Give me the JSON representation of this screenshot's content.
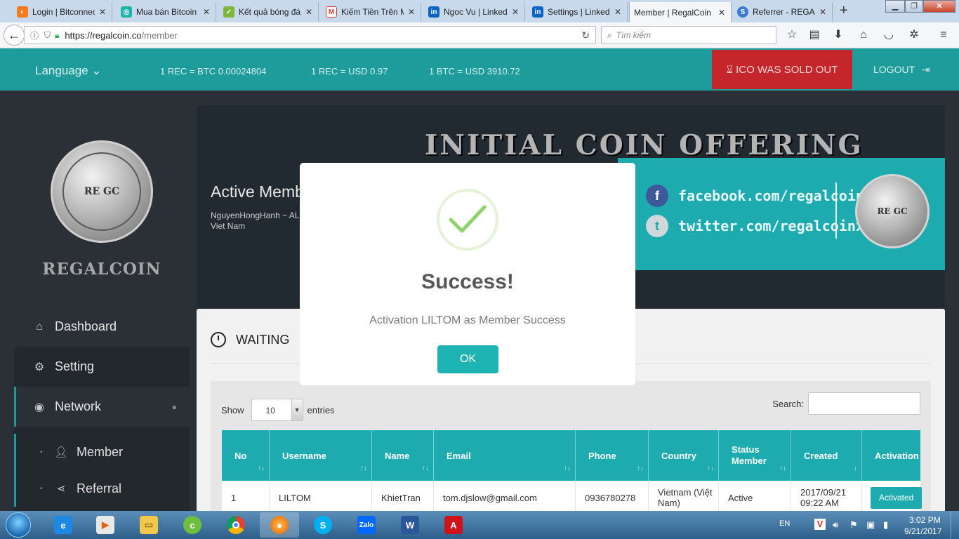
{
  "browser": {
    "tabs": [
      {
        "title": "Login | Bitconnect",
        "favicon": "bitconnect-icon",
        "color": "#f47a20"
      },
      {
        "title": "Mua bán Bitcoin",
        "favicon": "bitcoin-site-icon",
        "color": "#1fb5a8"
      },
      {
        "title": "Kết quả bóng đá",
        "favicon": "check-icon",
        "color": "#7fb73a"
      },
      {
        "title": "Kiếm Tiền Trên Mạng",
        "favicon": "gmail-icon",
        "color": "#d23f31"
      },
      {
        "title": "Ngoc Vu | LinkedIn",
        "favicon": "linkedin-icon",
        "color": "#0a66c2"
      },
      {
        "title": "Settings | LinkedIn",
        "favicon": "linkedin-icon",
        "color": "#0a66c2"
      },
      {
        "title": "Member | RegalCoin",
        "favicon": "none",
        "color": "#f5f6f7"
      },
      {
        "title": "Referrer - REGALCOIN",
        "favicon": "regalcoin-icon",
        "color": "#3a7bd5"
      }
    ],
    "new_tab": "+",
    "url_host": "https://regalcoin.co",
    "url_path": "/member",
    "search_placeholder": "Tìm kiếm"
  },
  "header": {
    "language_label": "Language",
    "rates": [
      "1 REC = BTC 0.00024804",
      "1 REC = USD 0.97",
      "1 BTC = USD 3910.72"
    ],
    "ico_status": "ICO WAS SOLD OUT",
    "logout_label": "LOGOUT"
  },
  "sidebar": {
    "brand": "REGALCOIN",
    "coin_text": "RE GC",
    "items": [
      {
        "label": "Dashboard",
        "icon": "home-icon"
      },
      {
        "label": "Setting",
        "icon": "gears-icon"
      },
      {
        "label": "Network",
        "icon": "podcast-icon"
      }
    ],
    "subitems": [
      {
        "label": "Member",
        "icon": "user-icon"
      },
      {
        "label": "Referral",
        "icon": "share-icon"
      }
    ]
  },
  "banner": {
    "title": "INITIAL COIN OFFERING",
    "facebook": "facebook.com/regalcoin",
    "twitter": "twitter.com/regalcoinx",
    "page_title": "Active Memb",
    "user_line": "NguyenHongHanh ~ AL",
    "country_line": "Viet Nam"
  },
  "panel": {
    "section_title": "WAITING",
    "show_label": "Show",
    "entries_value": "10",
    "entries_label": "entries",
    "search_label": "Search:",
    "columns": [
      "No",
      "Username",
      "Name",
      "Email",
      "Phone",
      "Country",
      "Status Member",
      "Created",
      "Activation"
    ],
    "rows": [
      {
        "no": "1",
        "username": "LILTOM",
        "name": "KhietTran",
        "email": "tom.djslow@gmail.com",
        "phone": "0936780278",
        "country": "Vietnam (Việt Nam)",
        "status": "Active",
        "created": "2017/09/21 09:22 AM",
        "activation": "Activated"
      }
    ]
  },
  "modal": {
    "title": "Success!",
    "message": "Activation LILTOM as Member Success",
    "ok_label": "OK",
    "accent": "#1eb4b4",
    "check_color": "#8cd46a"
  },
  "taskbar": {
    "apps": [
      "internet-explorer-icon",
      "media-center-icon",
      "file-explorer-icon",
      "coc-coc-icon",
      "chrome-icon",
      "firefox-icon",
      "skype-icon",
      "zalo-icon",
      "word-icon",
      "acrobat-icon"
    ],
    "lang": "EN",
    "time": "3:02 PM",
    "date": "9/21/2017"
  }
}
